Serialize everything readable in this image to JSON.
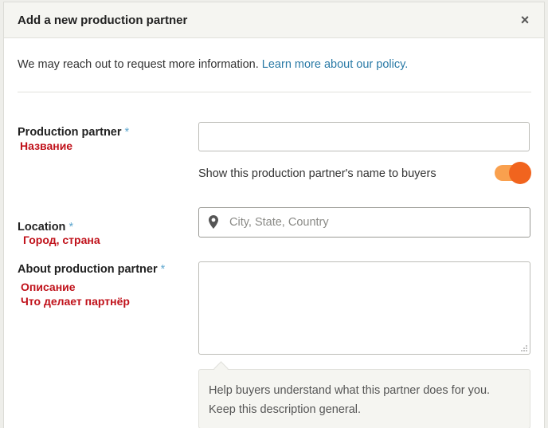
{
  "dialog": {
    "title": "Add a new production partner",
    "close_label": "×"
  },
  "intro": {
    "text": "We may reach out to request more information. ",
    "link": "Learn more about our policy."
  },
  "fields": {
    "required_mark": "*",
    "partner": {
      "label": "Production partner",
      "value": "",
      "note": "Название"
    },
    "visibility_toggle": {
      "label": "Show this production partner's name to buyers",
      "on": true,
      "icon": "toggle-switch"
    },
    "location": {
      "label": "Location",
      "placeholder": "City, State, Country",
      "note": "Город, страна",
      "icon": "map-pin-icon"
    },
    "about": {
      "label": "About production partner",
      "value": "",
      "note_line1": "Описание",
      "note_line2": "Что делает партнёр",
      "help_line1": "Help buyers understand what this partner does for you.",
      "help_line2": "Keep this description general."
    }
  },
  "colors": {
    "accent_orange": "#f1641e",
    "toggle_track": "#f9a04e",
    "link_blue": "#2a7aa6",
    "annotation_red": "#c0111a"
  }
}
